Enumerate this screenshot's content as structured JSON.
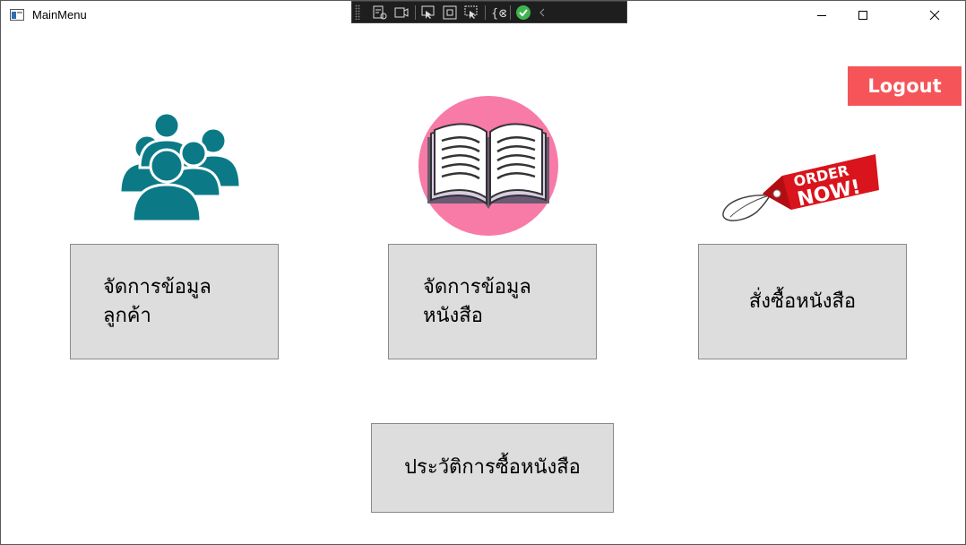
{
  "window": {
    "title": "MainMenu"
  },
  "header": {
    "logout_label": "Logout"
  },
  "menu": {
    "manage_customers_label": "จัดการข้อมูลลูกค้า",
    "manage_books_label": "จัดการข้อมูลหนังสือ",
    "order_books_label": "สั่งซื้อหนังสือ",
    "purchase_history_label": "ประวัติการซื้อหนังสือ"
  },
  "images": {
    "customers_icon": "users-group-icon",
    "books_icon": "open-book-icon",
    "order_icon": "order-now-tag-icon",
    "order_tag_text_line1": "ORDER",
    "order_tag_text_line2": "NOW!"
  },
  "colors": {
    "logout_bg": "#f55558",
    "users_icon": "#0b7a86",
    "book_circle": "#f77ba6",
    "order_tag": "#d9141c",
    "button_bg": "#dddddd"
  }
}
